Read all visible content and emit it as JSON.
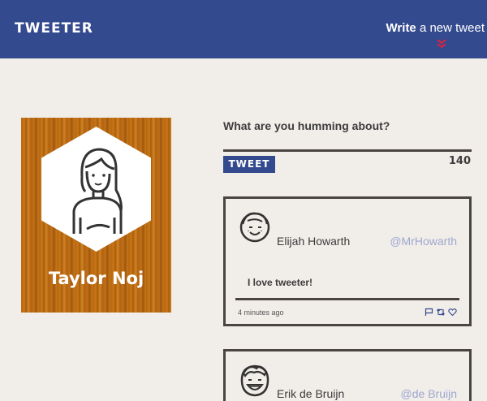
{
  "header": {
    "logo": "TWEETER",
    "write_bold": "Write",
    "write_rest": " a new tweet",
    "accent": "#344a8f"
  },
  "profile": {
    "name": "Taylor Noj"
  },
  "composer": {
    "prompt": "What are you humming about?",
    "button": "TWEET",
    "counter": "140"
  },
  "tweets": [
    {
      "name": "Elijah Howarth",
      "handle": "@MrHowarth",
      "text": "I love tweeter!",
      "time": "4 minutes ago"
    },
    {
      "name": "Erik de Bruijn",
      "handle": "@de Bruijn"
    }
  ],
  "icons": [
    "chevron-down-icon",
    "reply-icon",
    "retweet-icon",
    "heart-icon"
  ]
}
